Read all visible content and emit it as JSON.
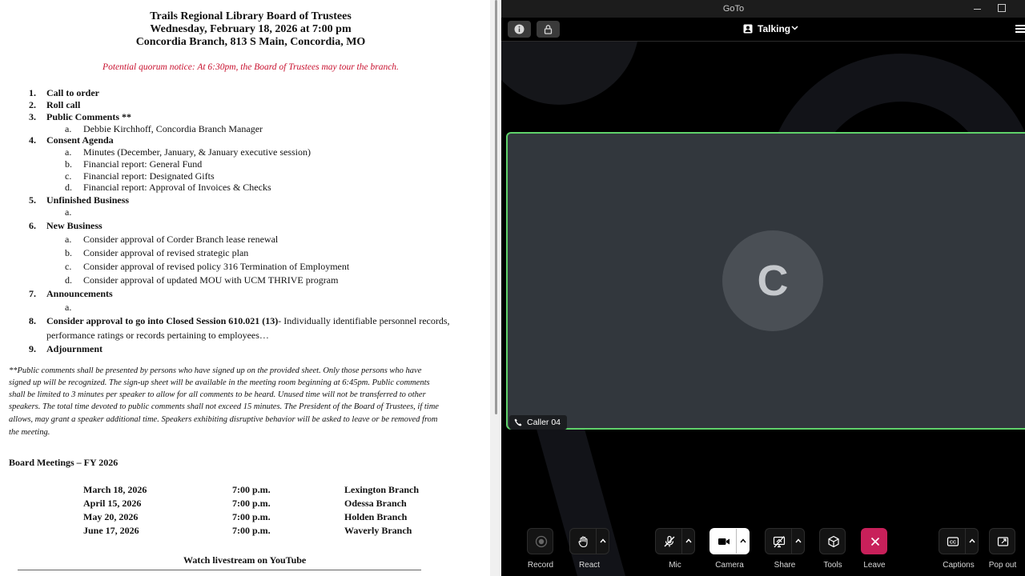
{
  "document": {
    "title_lines": [
      "Trails Regional Library Board of Trustees",
      "Wednesday, February 18, 2026 at 7:00 pm",
      "Concordia Branch, 813 S Main, Concordia, MO"
    ],
    "quorum_notice": "Potential quorum notice:  At 6:30pm, the Board of Trustees may tour the branch.",
    "agenda": {
      "i1": {
        "num": "1.",
        "text": "Call to order"
      },
      "i2": {
        "num": "2.",
        "text": "Roll call"
      },
      "i3": {
        "num": "3.",
        "text": "Public Comments **",
        "a": "Debbie Kirchhoff, Concordia Branch Manager"
      },
      "i4": {
        "num": "4.",
        "text": "Consent Agenda",
        "a": "Minutes (December, January, & January executive session)",
        "b": "Financial report: General Fund",
        "c": "Financial report: Designated Gifts",
        "d": "Financial report: Approval of Invoices & Checks"
      },
      "i5": {
        "num": "5.",
        "text": "Unfinished Business"
      },
      "i6": {
        "num": "6.",
        "text": "New Business",
        "a": "Consider approval of Corder Branch lease renewal",
        "b": "Consider approval of revised strategic plan",
        "c": "Consider approval of revised policy 316 Termination of Employment",
        "d": "Consider approval of updated MOU with UCM THRIVE program"
      },
      "i7": {
        "num": "7.",
        "text": "Announcements"
      },
      "i8": {
        "num": "8.",
        "bold": "Consider approval to go into Closed Session 610.021 (13)",
        "rest": "- Individually identifiable personnel records,",
        "line2": "performance ratings or records pertaining to employees…"
      },
      "i9": {
        "num": "9.",
        "text": "Adjournment"
      }
    },
    "letters": {
      "a": "a.",
      "b": "b.",
      "c": "c.",
      "d": "d."
    },
    "footnote_lines": [
      "**Public comments shall be presented by persons who have signed up on the provided sheet.  Only those persons who have",
      "signed up will be recognized.  The sign-up sheet will be available in the meeting room beginning at 6:45pm.  Public comments",
      "shall be limited to 3 minutes per speaker to allow for all comments to be heard.  Unused time will not be transferred to other",
      "speakers.  The total time devoted to public comments shall not exceed 15 minutes.  The President of the Board of Trustees, if time",
      "allows, may grant a speaker additional time.  Speakers exhibiting disruptive behavior will be asked to leave or be removed from",
      "the meeting."
    ],
    "meetings_heading": "Board Meetings – FY 2026",
    "meetings": [
      {
        "date": "March 18, 2026",
        "time": "7:00 p.m.",
        "location": "Lexington Branch"
      },
      {
        "date": "April 15, 2026",
        "time": "7:00 p.m.",
        "location": "Odessa Branch"
      },
      {
        "date": "May 20, 2026",
        "time": "7:00 p.m.",
        "location": "Holden Branch"
      },
      {
        "date": "June 17, 2026",
        "time": "7:00 p.m.",
        "location": "Waverly Branch"
      }
    ],
    "livestream": "Watch livestream on YouTube"
  },
  "goto": {
    "app_title": "GoTo",
    "status_label": "Talking",
    "caller_initial": "C",
    "caller_name": "Caller 04",
    "toolbar": {
      "record": "Record",
      "react": "React",
      "mic": "Mic",
      "camera": "Camera",
      "share": "Share",
      "tools": "Tools",
      "leave": "Leave",
      "captions": "Captions",
      "popout": "Pop out"
    },
    "colors": {
      "active_speaker_border": "#5fd16a",
      "leave": "#c8205a",
      "tile": "#32373d"
    }
  }
}
